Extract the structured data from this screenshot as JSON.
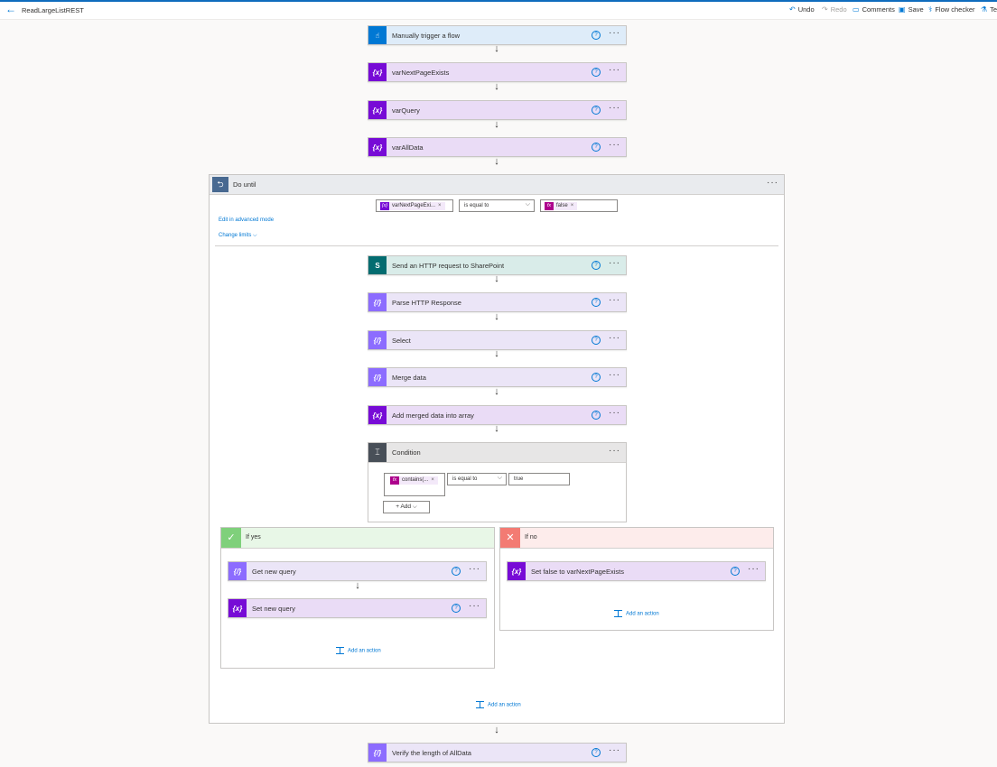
{
  "header": {
    "title": "ReadLargeListREST",
    "undo": "Undo",
    "redo": "Redo",
    "comments": "Comments",
    "save": "Save",
    "flow_checker": "Flow checker",
    "test": "Te"
  },
  "steps": {
    "trigger": "Manually trigger a flow",
    "var1": "varNextPageExists",
    "var2": "varQuery",
    "var3": "varAllData",
    "final": "Verify the length of AllData"
  },
  "do_until": {
    "title": "Do until",
    "left_token": "varNextPageExi...",
    "operator": "is equal to",
    "right_token": "false",
    "advanced_link": "Edit in advanced mode",
    "limits_link": "Change limits",
    "add_action": "Add an action",
    "actions": [
      "Send an HTTP request to SharePoint",
      "Parse HTTP Response",
      "Select",
      "Merge data",
      "Add merged data into array"
    ]
  },
  "condition": {
    "title": "Condition",
    "left_token": "contains(...",
    "operator": "is equal to",
    "right_value": "true",
    "add_label": "Add"
  },
  "if_yes": {
    "title": "If yes",
    "action1": "Get new query",
    "action2": "Set new query",
    "add_action": "Add an action"
  },
  "if_no": {
    "title": "If no",
    "action1": "Set false to varNextPageExists",
    "add_action": "Add an action"
  },
  "colors": {
    "variable": "#770bd6",
    "data_ops": "#8c6cff",
    "trigger": "#0078d4",
    "sharepoint": "#036c70",
    "yes": "#7fd07b",
    "no": "#f37b73"
  }
}
